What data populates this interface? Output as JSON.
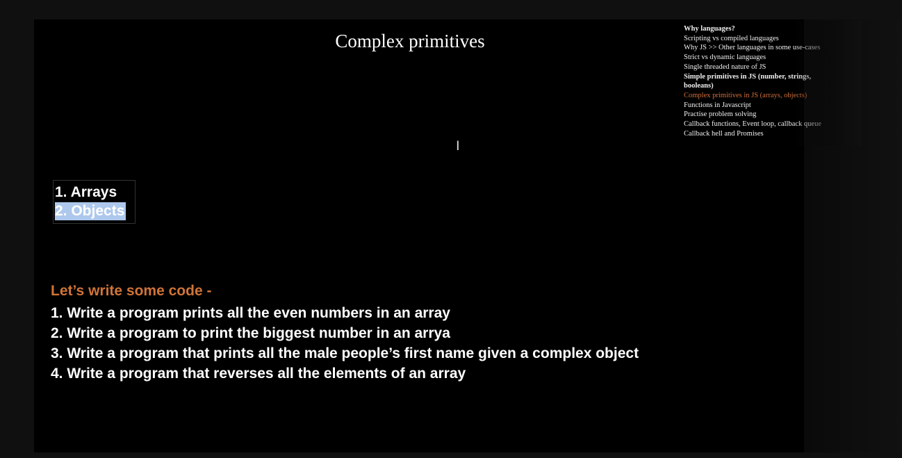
{
  "slide": {
    "title": "Complex primitives",
    "toc": [
      {
        "text": "Why languages?",
        "style": "bold"
      },
      {
        "text": "Scripting vs compiled languages",
        "style": "normal"
      },
      {
        "text": "Why JS >> Other languages in some use-cases",
        "style": "normal"
      },
      {
        "text": "Strict vs dynamic languages",
        "style": "normal"
      },
      {
        "text": "Single threaded nature of JS",
        "style": "normal"
      },
      {
        "text": "Simple primitives in JS (number, strings, booleans)",
        "style": "bold"
      },
      {
        "text": "Complex primitives in JS (arrays, objects)",
        "style": "current"
      },
      {
        "text": "Functions in Javascript",
        "style": "normal"
      },
      {
        "text": "Practise problem solving",
        "style": "normal"
      },
      {
        "text": "Callback functions, Event loop, callback queue",
        "style": "normal"
      },
      {
        "text": "Callback hell and Promises",
        "style": "normal"
      }
    ],
    "primitives": {
      "item1": "1. Arrays",
      "item2": "2. Objects"
    },
    "code_heading": "Let’s write some code -",
    "tasks": [
      "1.  Write a program prints all the even numbers in an array",
      "2.  Write a program to print the biggest number in an arrya",
      "3. Write a program that prints all the male people’s first name given a complex object",
      "4. Write a program that reverses all the elements of an array"
    ]
  },
  "colors": {
    "background": "#000000",
    "accent_orange": "#d07438",
    "selection_highlight": "#adc8ec"
  },
  "icons": {
    "cursor": "text-cursor-icon"
  }
}
